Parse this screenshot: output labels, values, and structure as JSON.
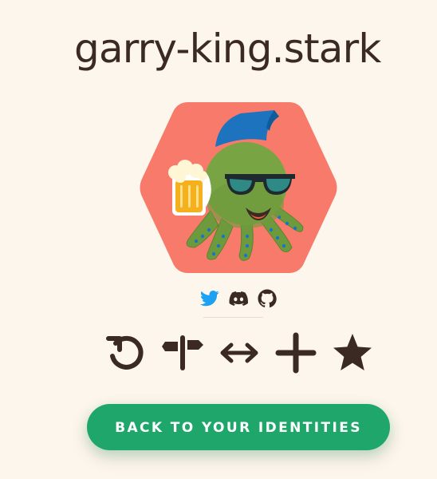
{
  "identity": {
    "name": "garry-king.stark"
  },
  "avatar": {
    "icon": "octopus-avatar-with-beer-and-sunglasses",
    "background_color": "#F87A6A"
  },
  "social": {
    "items": [
      {
        "icon": "twitter-icon",
        "color": "#1DA1F2"
      },
      {
        "icon": "discord-icon",
        "color": "#3A2A23"
      },
      {
        "icon": "github-icon",
        "color": "#3A2A23"
      }
    ]
  },
  "actions": {
    "items": [
      {
        "icon": "refresh-icon"
      },
      {
        "icon": "signpost-icon"
      },
      {
        "icon": "swap-arrows-icon"
      },
      {
        "icon": "plus-icon"
      },
      {
        "icon": "star-icon"
      }
    ]
  },
  "back_button": {
    "label": "BACK TO YOUR IDENTITIES",
    "color": "#1EA66B"
  },
  "colors": {
    "background": "#FDF6EC",
    "text": "#3A2A23"
  }
}
